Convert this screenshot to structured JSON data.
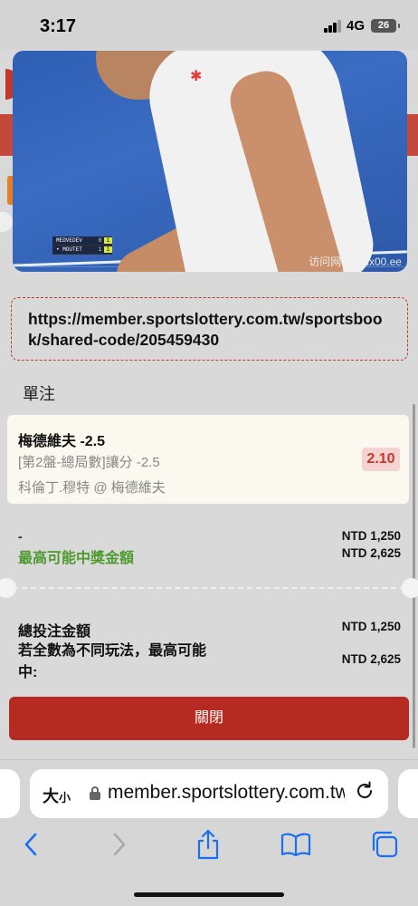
{
  "status_bar": {
    "time": "3:17",
    "network": "4G",
    "battery": "26"
  },
  "video": {
    "scoreboard": [
      {
        "name": "MEDVEDEV",
        "set1": "6",
        "set2": "1"
      },
      {
        "name": "• MOUTET",
        "set1": "1",
        "set2": "1"
      }
    ],
    "watermark": "访问网址：hx00.ee"
  },
  "share": {
    "url": "https://member.sportslottery.com.tw/sportsbook/shared-code/205459430"
  },
  "bet_type_title": "單注",
  "bet": {
    "selection": "梅德維夫 -2.5",
    "market": "[第2盤-總局數]讓分 -2.5",
    "match": "科倫丁.穆特 @ 梅德維夫",
    "odds": "2.10"
  },
  "summary": {
    "dash": "-",
    "max_win_label": "最高可能中獎金額",
    "stake_amount": "NTD 1,250",
    "max_win_amount": "NTD 2,625",
    "total_label": "總投注金額",
    "total_amount": "NTD 1,250",
    "all_in_label": "若全數為不同玩法，最高可能中:",
    "all_in_amount": "NTD 2,625"
  },
  "close_button": "關閉",
  "browser": {
    "text_size_label": "大",
    "text_size_small": "小",
    "url_display": "member.sportslottery.com.tw"
  },
  "icons": {
    "back": "chevron-left-icon",
    "forward": "chevron-right-icon",
    "share": "share-icon",
    "bookmarks": "book-icon",
    "tabs": "tabs-icon",
    "reload": "reload-icon",
    "lock": "lock-icon"
  },
  "colors": {
    "accent_red": "#b52a21",
    "win_green": "#4e9a2e",
    "odds_bg": "#f5d3d0",
    "ios_blue": "#1a6ff2"
  }
}
